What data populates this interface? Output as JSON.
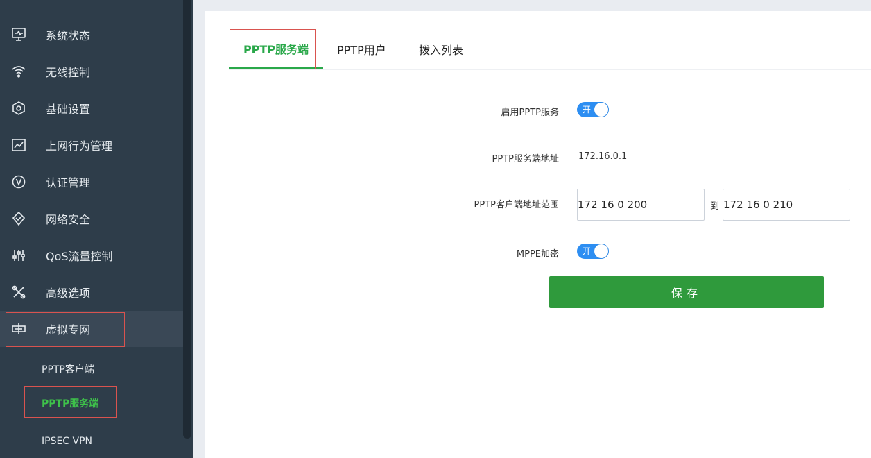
{
  "sidebar": {
    "items": [
      {
        "label": "系统状态",
        "icon": "monitor-icon"
      },
      {
        "label": "无线控制",
        "icon": "wifi-icon"
      },
      {
        "label": "基础设置",
        "icon": "hexagon-settings-icon"
      },
      {
        "label": "上网行为管理",
        "icon": "chart-icon"
      },
      {
        "label": "认证管理",
        "icon": "verify-icon"
      },
      {
        "label": "网络安全",
        "icon": "shield-icon"
      },
      {
        "label": "QoS流量控制",
        "icon": "sliders-icon"
      },
      {
        "label": "高级选项",
        "icon": "tools-icon"
      },
      {
        "label": "虚拟专网",
        "icon": "vpn-icon"
      }
    ],
    "active_item": "虚拟专网",
    "sub_items": [
      {
        "label": "PPTP客户端"
      },
      {
        "label": "PPTP服务端"
      },
      {
        "label": "IPSEC VPN"
      }
    ],
    "active_sub_item": "PPTP服务端"
  },
  "tabs": [
    {
      "label": "PPTP服务端"
    },
    {
      "label": "PPTP用户"
    },
    {
      "label": "拨入列表"
    }
  ],
  "active_tab": "PPTP服务端",
  "form": {
    "enable_label": "启用PPTP服务",
    "enable_toggle_text": "开",
    "enable_on": true,
    "server_addr_label": "PPTP服务端地址",
    "server_addr_value": "172.16.0.1",
    "client_range_label": "PPTP客户端地址范围",
    "client_range_start": "172 16 0 200",
    "range_separator": "到",
    "client_range_end": "172 16 0 210",
    "mppe_label": "MPPE加密",
    "mppe_toggle_text": "开",
    "mppe_on": true,
    "save_label": "保存"
  },
  "colors": {
    "sidebar_bg": "#2e3d4a",
    "accent_green": "#2aa84a",
    "toggle_blue": "#2d8ef2",
    "highlight_red": "#d9534f"
  }
}
